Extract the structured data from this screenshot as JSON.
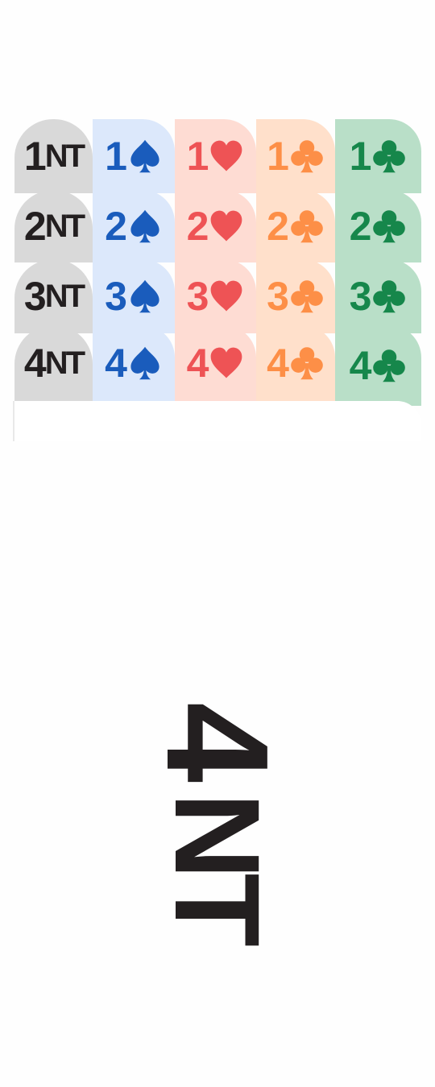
{
  "bidding_box": {
    "rows": [
      {
        "level": "1",
        "nt": "NT",
        "spade": "1",
        "heart": "1",
        "diamond": "1",
        "club": "1"
      },
      {
        "level": "2",
        "nt": "NT",
        "spade": "2",
        "heart": "2",
        "diamond": "2",
        "club": "2"
      },
      {
        "level": "3",
        "nt": "NT",
        "spade": "3",
        "heart": "3",
        "diamond": "3",
        "club": "3"
      },
      {
        "level": "4",
        "nt": "NT",
        "spade": "4",
        "heart": "4",
        "diamond": "4",
        "club": "4"
      }
    ],
    "colors": {
      "nt_bg": "#d9d9d9",
      "nt_text": "#231f20",
      "spade_bg": "#dce8fb",
      "spade_text": "#1a5cbc",
      "heart_bg": "#fedcd3",
      "heart_text": "#ee5355",
      "diamond_bg": "#ffe0cb",
      "diamond_text": "#fd8f47",
      "club_bg": "#b9dfc8",
      "club_text": "#16874b"
    },
    "icons": {
      "spade": "spade-icon",
      "heart": "heart-icon",
      "diamond": "club-icon",
      "club": "club-icon"
    }
  },
  "selected_bid": {
    "level": "4",
    "strain": "NT"
  }
}
